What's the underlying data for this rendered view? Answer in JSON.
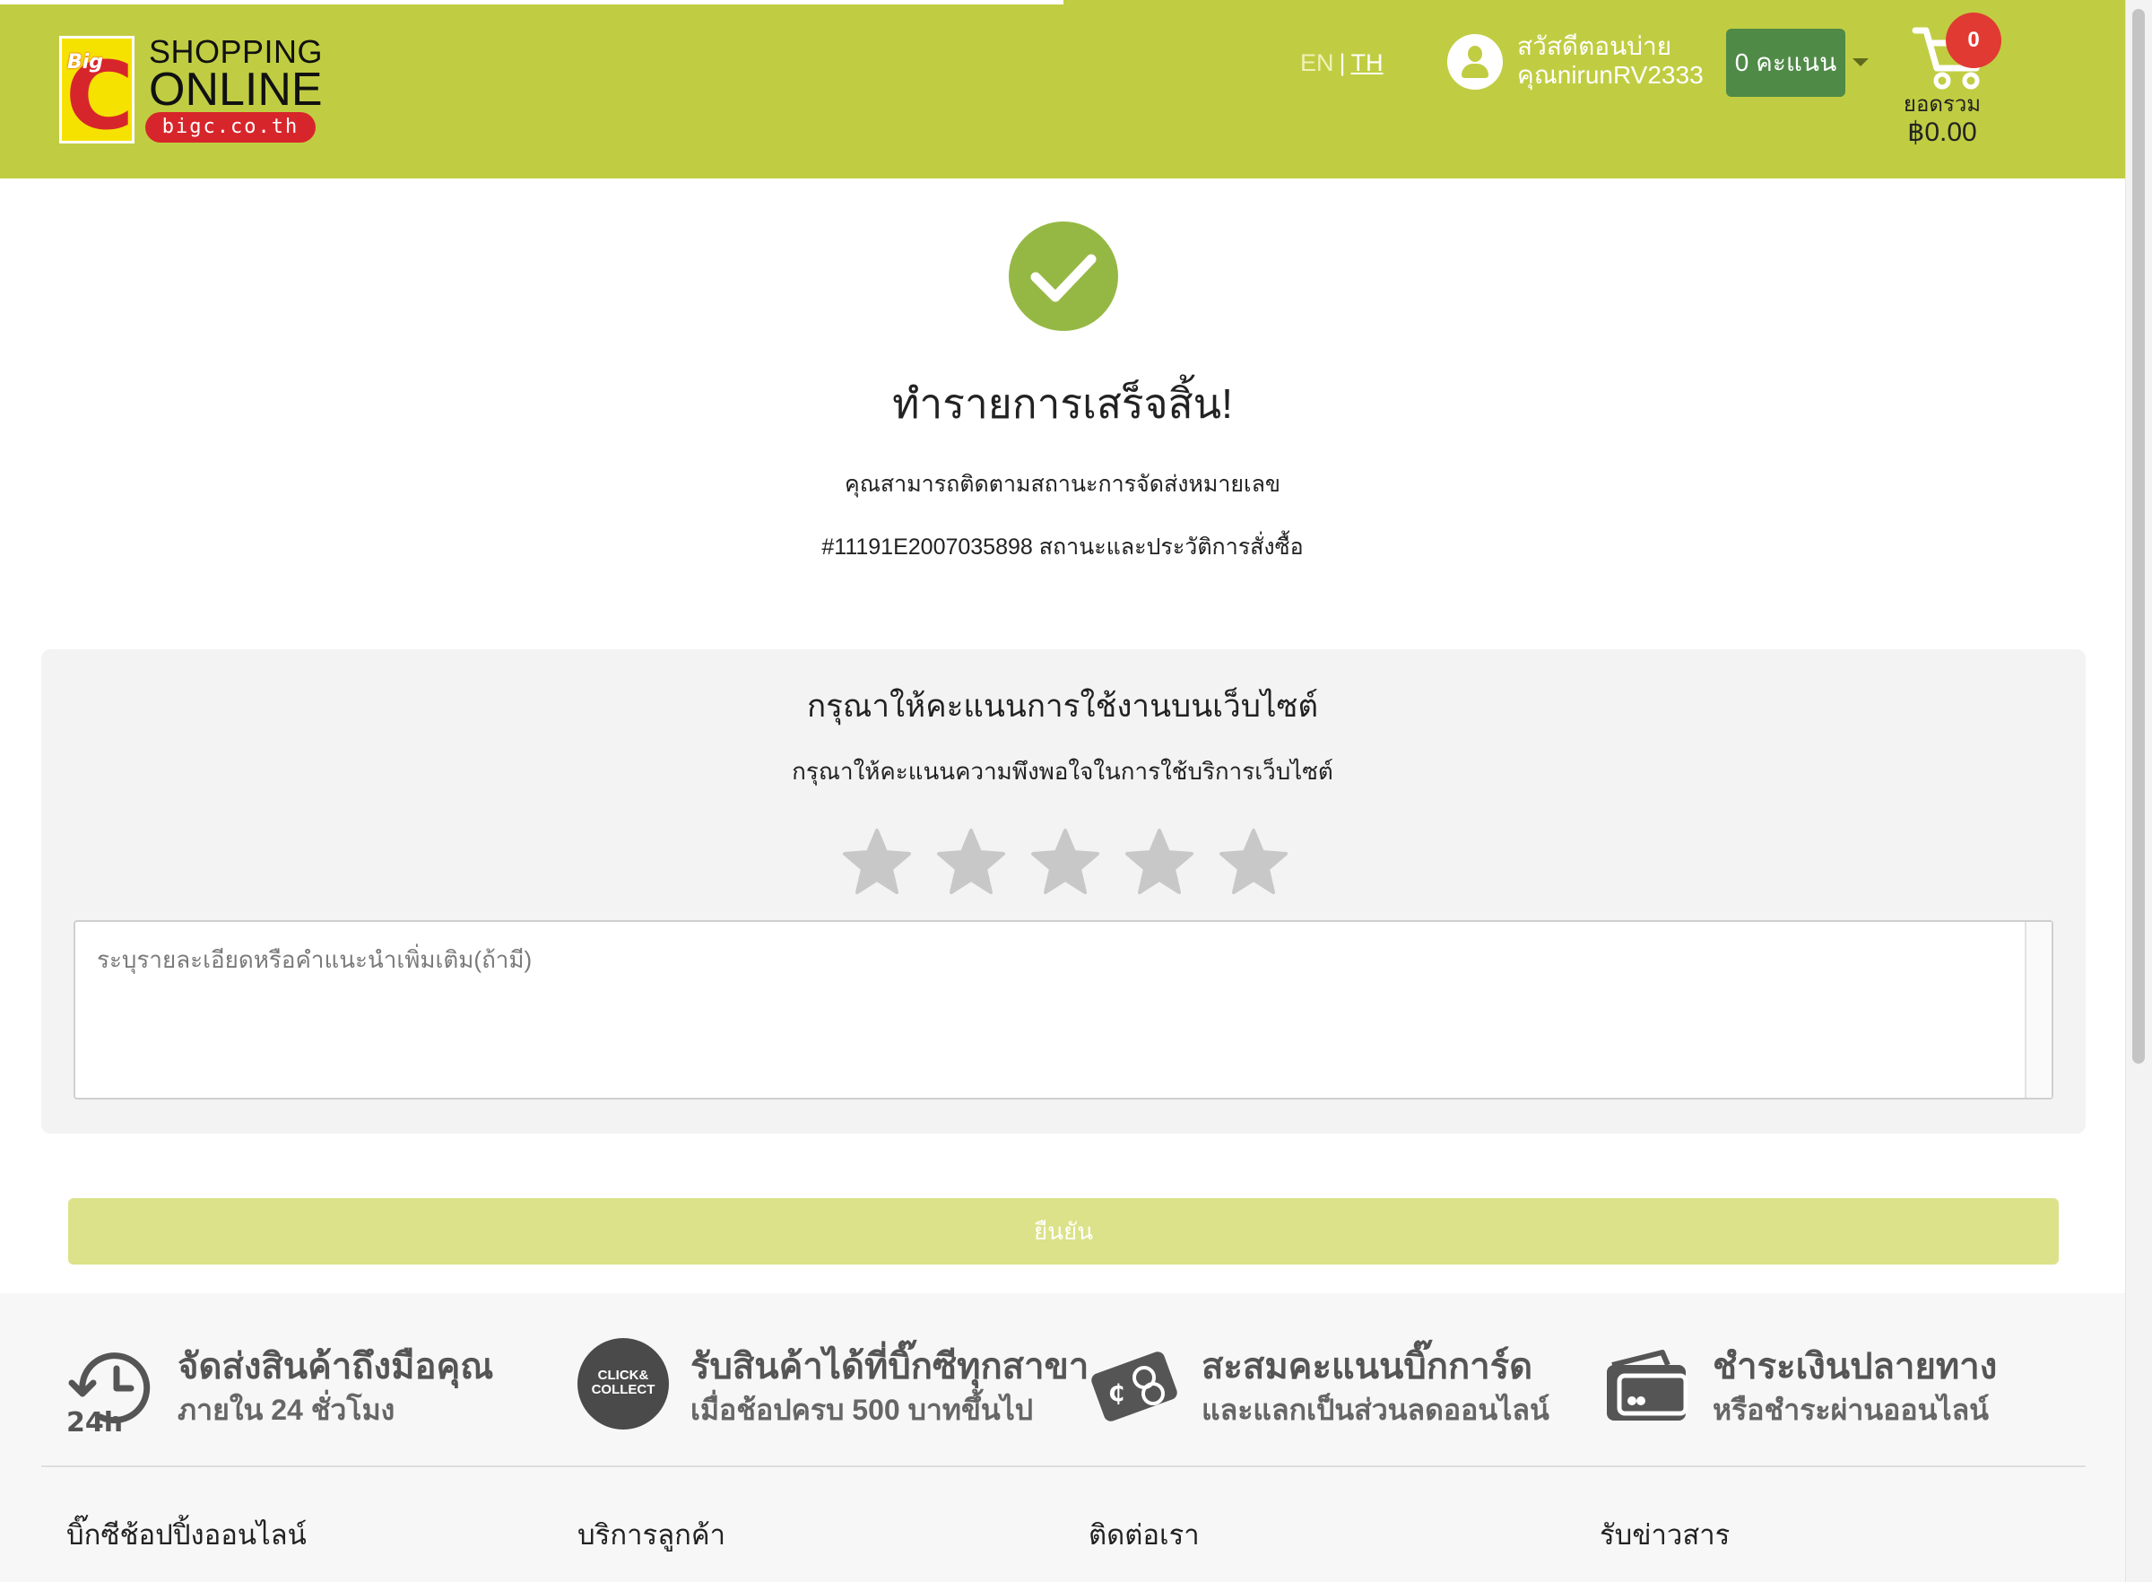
{
  "header": {
    "logo": {
      "big": "Big",
      "c": "C",
      "line1": "SHOPPING",
      "line2": "ONLINE",
      "url": "bigc.co.th"
    },
    "lang": {
      "en": "EN",
      "separator": "|",
      "th": "TH"
    },
    "greeting": "สวัสดีตอนบ่าย",
    "username": "คุณnirunRV2333",
    "points": "0 คะแนน",
    "cart": {
      "count": "0",
      "label": "ยอดรวม",
      "total": "฿0.00"
    },
    "colors": {
      "bar": "#c0cd42",
      "points_btn": "#4f8a47",
      "badge": "#e13a32"
    }
  },
  "success": {
    "icon": "check-icon",
    "title": "ทำรายการเสร็จสิ้น!",
    "line1": "คุณสามารถติดตามสถานะการจัดส่งหมายเลข",
    "line2": "#11191E2007035898 สถานะและประวัติการสั่งซื้อ"
  },
  "rating": {
    "title": "กรุณาให้คะแนนการใช้งานบนเว็บไซต์",
    "subtitle": "กรุณาให้คะแนนความพึงพอใจในการใช้บริการเว็บไซต์",
    "stars_selected": 0,
    "stars_total": 5,
    "feedback_placeholder": "ระบุรายละเอียดหรือคำแนะนำเพิ่มเติม(ถ้ามี)",
    "feedback_value": "",
    "confirm_label": "ยืนยัน"
  },
  "features": [
    {
      "icon": "24h-delivery-icon",
      "icon_text": "24h",
      "title": "จัดส่งสินค้าถึงมือคุณ",
      "subtitle": "ภายใน 24 ชั่วโมง"
    },
    {
      "icon": "click-collect-icon",
      "icon_text": "CLICK& COLLECT",
      "title": "รับสินค้าได้ที่บิ๊กซีทุกสาขา",
      "subtitle": "เมื่อช้อปครบ 500 บาทขึ้นไป"
    },
    {
      "icon": "card-points-icon",
      "title": "สะสมคะแนนบิ๊กการ์ด",
      "subtitle": "และแลกเป็นส่วนลดออนไลน์"
    },
    {
      "icon": "wallet-payment-icon",
      "title": "ชำระเงินปลายทาง",
      "subtitle": "หรือชำระผ่านออนไลน์"
    }
  ],
  "footer_columns": [
    "บิ๊กซีช้อปปิ้งออนไลน์",
    "บริการลูกค้า",
    "ติดต่อเรา",
    "รับข่าวสาร"
  ]
}
